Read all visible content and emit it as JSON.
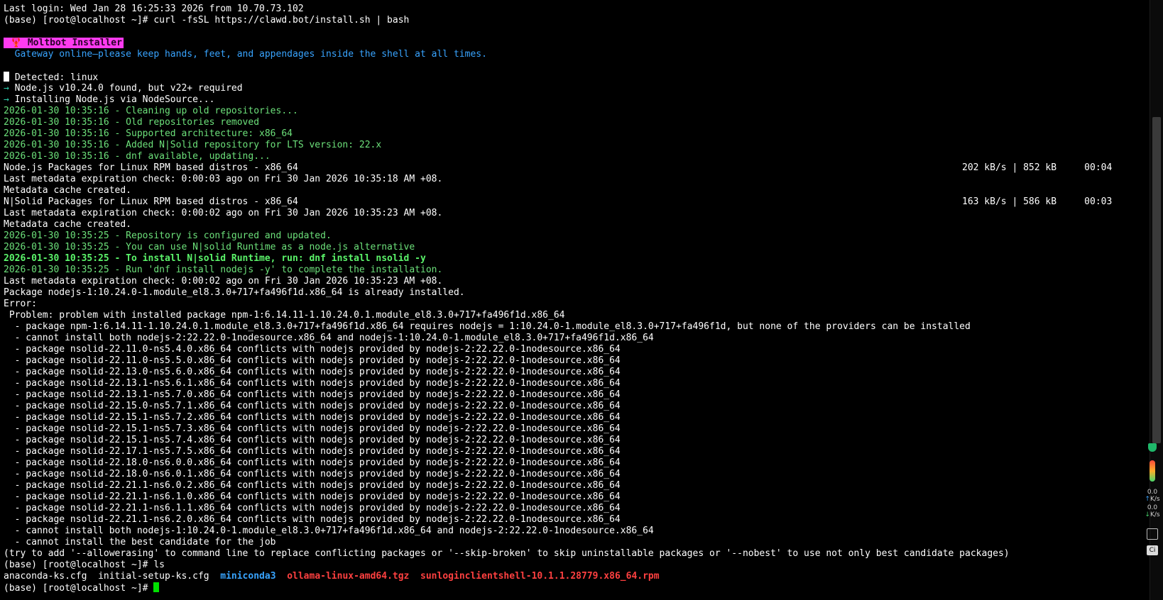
{
  "terminal": {
    "lines": [
      {
        "cls": "white",
        "text": "Last login: Wed Jan 28 16:25:33 2026 from 10.70.73.102"
      },
      {
        "cls": "white",
        "text": "(base) [root@localhost ~]# curl -fsSL https://clawd.bot/install.sh | bash"
      },
      {
        "cls": "white",
        "text": ""
      },
      {
        "cls": "badge",
        "text": " 🦞 Moltbot Installer"
      },
      {
        "cls": "blue",
        "text": "  Gateway online—please keep hands, feet, and appendages inside the shell at all times."
      },
      {
        "cls": "white",
        "text": ""
      },
      {
        "cls": "detected",
        "text": " Detected: linux"
      },
      {
        "cls": "arrowline",
        "text": " Node.js v10.24.0 found, but v22+ required"
      },
      {
        "cls": "arrowline",
        "text": " Installing Node.js via NodeSource..."
      },
      {
        "cls": "green",
        "text": "2026-01-30 10:35:16 - Cleaning up old repositories..."
      },
      {
        "cls": "green",
        "text": "2026-01-30 10:35:16 - Old repositories removed"
      },
      {
        "cls": "green",
        "text": "2026-01-30 10:35:16 - Supported architecture: x86_64"
      },
      {
        "cls": "green",
        "text": "2026-01-30 10:35:16 - Added N|Solid repository for LTS version: 22.x"
      },
      {
        "cls": "green",
        "text": "2026-01-30 10:35:16 - dnf available, updating..."
      },
      {
        "cls": "rateline",
        "text": "Node.js Packages for Linux RPM based distros - x86_64",
        "rate": "202 kB/s | 852 kB     00:04"
      },
      {
        "cls": "white",
        "text": "Last metadata expiration check: 0:00:03 ago on Fri 30 Jan 2026 10:35:18 AM +08."
      },
      {
        "cls": "white",
        "text": "Metadata cache created."
      },
      {
        "cls": "rateline",
        "text": "N|Solid Packages for Linux RPM based distros - x86_64",
        "rate": "163 kB/s | 586 kB     00:03"
      },
      {
        "cls": "white",
        "text": "Last metadata expiration check: 0:00:02 ago on Fri 30 Jan 2026 10:35:23 AM +08."
      },
      {
        "cls": "white",
        "text": "Metadata cache created."
      },
      {
        "cls": "green",
        "text": "2026-01-30 10:35:25 - Repository is configured and updated."
      },
      {
        "cls": "green",
        "text": "2026-01-30 10:35:25 - You can use N|solid Runtime as a node.js alternative"
      },
      {
        "cls": "green-bold",
        "text": "2026-01-30 10:35:25 - To install N|solid Runtime, run: dnf install nsolid -y"
      },
      {
        "cls": "green",
        "text": "2026-01-30 10:35:25 - Run 'dnf install nodejs -y' to complete the installation."
      },
      {
        "cls": "white",
        "text": "Last metadata expiration check: 0:00:02 ago on Fri 30 Jan 2026 10:35:23 AM +08."
      },
      {
        "cls": "white",
        "text": "Package nodejs-1:10.24.0-1.module_el8.3.0+717+fa496f1d.x86_64 is already installed."
      },
      {
        "cls": "white",
        "text": "Error:"
      },
      {
        "cls": "white",
        "text": " Problem: problem with installed package npm-1:6.14.11-1.10.24.0.1.module_el8.3.0+717+fa496f1d.x86_64"
      },
      {
        "cls": "white",
        "text": "  - package npm-1:6.14.11-1.10.24.0.1.module_el8.3.0+717+fa496f1d.x86_64 requires nodejs = 1:10.24.0-1.module_el8.3.0+717+fa496f1d, but none of the providers can be installed"
      },
      {
        "cls": "white",
        "text": "  - cannot install both nodejs-2:22.22.0-1nodesource.x86_64 and nodejs-1:10.24.0-1.module_el8.3.0+717+fa496f1d.x86_64"
      },
      {
        "cls": "white",
        "text": "  - package nsolid-22.11.0-ns5.4.0.x86_64 conflicts with nodejs provided by nodejs-2:22.22.0-1nodesource.x86_64"
      },
      {
        "cls": "white",
        "text": "  - package nsolid-22.11.0-ns5.5.0.x86_64 conflicts with nodejs provided by nodejs-2:22.22.0-1nodesource.x86_64"
      },
      {
        "cls": "white",
        "text": "  - package nsolid-22.13.0-ns5.6.0.x86_64 conflicts with nodejs provided by nodejs-2:22.22.0-1nodesource.x86_64"
      },
      {
        "cls": "white",
        "text": "  - package nsolid-22.13.1-ns5.6.1.x86_64 conflicts with nodejs provided by nodejs-2:22.22.0-1nodesource.x86_64"
      },
      {
        "cls": "white",
        "text": "  - package nsolid-22.13.1-ns5.7.0.x86_64 conflicts with nodejs provided by nodejs-2:22.22.0-1nodesource.x86_64"
      },
      {
        "cls": "white",
        "text": "  - package nsolid-22.15.0-ns5.7.1.x86_64 conflicts with nodejs provided by nodejs-2:22.22.0-1nodesource.x86_64"
      },
      {
        "cls": "white",
        "text": "  - package nsolid-22.15.1-ns5.7.2.x86_64 conflicts with nodejs provided by nodejs-2:22.22.0-1nodesource.x86_64"
      },
      {
        "cls": "white",
        "text": "  - package nsolid-22.15.1-ns5.7.3.x86_64 conflicts with nodejs provided by nodejs-2:22.22.0-1nodesource.x86_64"
      },
      {
        "cls": "white",
        "text": "  - package nsolid-22.15.1-ns5.7.4.x86_64 conflicts with nodejs provided by nodejs-2:22.22.0-1nodesource.x86_64"
      },
      {
        "cls": "white",
        "text": "  - package nsolid-22.17.1-ns5.7.5.x86_64 conflicts with nodejs provided by nodejs-2:22.22.0-1nodesource.x86_64"
      },
      {
        "cls": "white",
        "text": "  - package nsolid-22.18.0-ns6.0.0.x86_64 conflicts with nodejs provided by nodejs-2:22.22.0-1nodesource.x86_64"
      },
      {
        "cls": "white",
        "text": "  - package nsolid-22.18.0-ns6.0.1.x86_64 conflicts with nodejs provided by nodejs-2:22.22.0-1nodesource.x86_64"
      },
      {
        "cls": "white",
        "text": "  - package nsolid-22.21.1-ns6.0.2.x86_64 conflicts with nodejs provided by nodejs-2:22.22.0-1nodesource.x86_64"
      },
      {
        "cls": "white",
        "text": "  - package nsolid-22.21.1-ns6.1.0.x86_64 conflicts with nodejs provided by nodejs-2:22.22.0-1nodesource.x86_64"
      },
      {
        "cls": "white",
        "text": "  - package nsolid-22.21.1-ns6.1.1.x86_64 conflicts with nodejs provided by nodejs-2:22.22.0-1nodesource.x86_64"
      },
      {
        "cls": "white",
        "text": "  - package nsolid-22.21.1-ns6.2.0.x86_64 conflicts with nodejs provided by nodejs-2:22.22.0-1nodesource.x86_64"
      },
      {
        "cls": "white",
        "text": "  - cannot install both nodejs-1:10.24.0-1.module_el8.3.0+717+fa496f1d.x86_64 and nodejs-2:22.22.0-1nodesource.x86_64"
      },
      {
        "cls": "white",
        "text": "  - cannot install the best candidate for the job"
      },
      {
        "cls": "white",
        "text": "(try to add '--allowerasing' to command line to replace conflicting packages or '--skip-broken' to skip uninstallable packages or '--nobest' to use not only best candidate packages)"
      },
      {
        "cls": "white",
        "text": "(base) [root@localhost ~]# ls"
      }
    ],
    "ls_output": [
      {
        "cls": "white",
        "text": "anaconda-ks.cfg  "
      },
      {
        "cls": "white",
        "text": "initial-setup-ks.cfg  "
      },
      {
        "cls": "ls-dir",
        "text": "miniconda3"
      },
      {
        "cls": "white",
        "text": "  "
      },
      {
        "cls": "ls-red",
        "text": "ollama-linux-amd64.tgz"
      },
      {
        "cls": "white",
        "text": "  "
      },
      {
        "cls": "ls-red",
        "text": "sunloginclientshell-10.1.1.28779.x86_64.rpm"
      }
    ],
    "prompt": "(base) [root@localhost ~]# ",
    "arrow_glyph": "→"
  },
  "side_widget": {
    "up_speed": "0.0",
    "up_unit": "K/s",
    "down_speed": "0.0",
    "down_unit": "K/s",
    "ai_label": "Ci"
  },
  "colors": {
    "background": "#000000",
    "green": "#6ce07a",
    "blue": "#38a4ff",
    "badge": "#ff3bf0",
    "error_red": "#ff4040"
  }
}
